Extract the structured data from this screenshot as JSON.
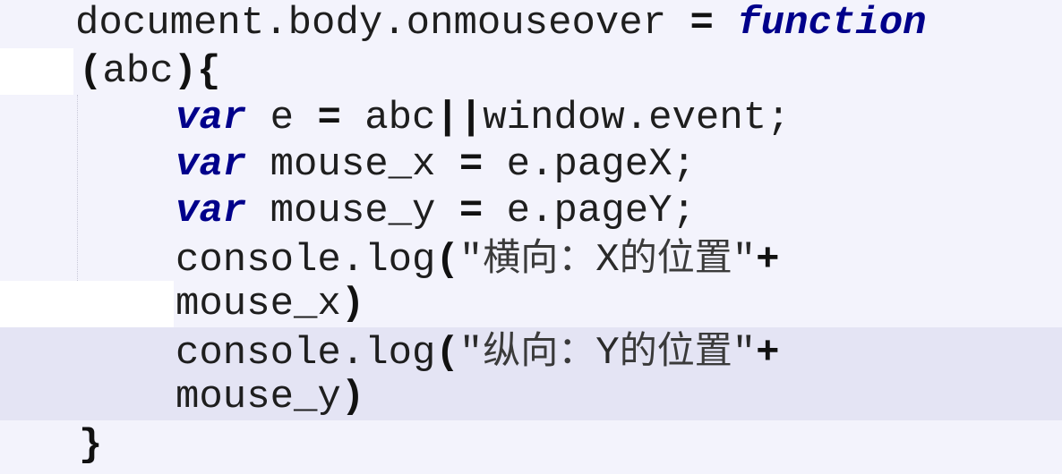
{
  "code": {
    "line1": {
      "text": "document.body.onmouseover ",
      "op": "=",
      "keyword": "function"
    },
    "line2": {
      "open_paren": "(",
      "param": "abc",
      "close": "){"
    },
    "line3": {
      "keyword": "var",
      "name": " e ",
      "op": "=",
      "expr1": " abc",
      "or": "||",
      "expr2": "window.event;"
    },
    "line4": {
      "keyword": "var",
      "name": " mouse_x ",
      "op": "=",
      "expr": " e.pageX;"
    },
    "line5": {
      "keyword": "var",
      "name": " mouse_y ",
      "op": "=",
      "expr": " e.pageY;"
    },
    "line6": {
      "call": "console.log",
      "open": "(",
      "q1": "\"",
      "str": "横向：",
      "str_ascii": "X",
      "str2": "的位置",
      "q2": "\"",
      "plus": "+"
    },
    "line7": {
      "var": "mouse_x",
      "close": ")"
    },
    "line8": {
      "call": "console.log",
      "open": "(",
      "q1": "\"",
      "str": "纵向：",
      "str_ascii": "Y",
      "str2": "的位置",
      "q2": "\"",
      "plus": "+"
    },
    "line9": {
      "var": "mouse_y",
      "close": ")"
    },
    "line10": {
      "close": "}"
    }
  },
  "colors": {
    "background": "#f3f3fc",
    "highlight": "#e4e4f4",
    "keyword": "#00008b",
    "text": "#1e1e1e"
  }
}
